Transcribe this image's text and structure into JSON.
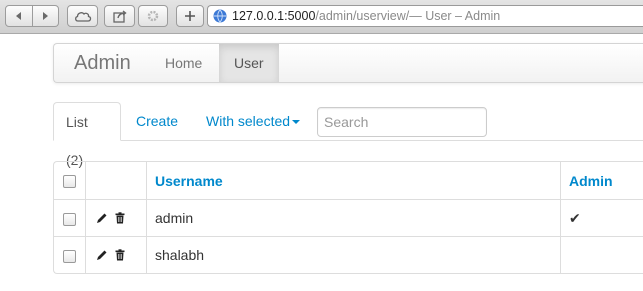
{
  "browser": {
    "url_host": "127.0.0.1:5000",
    "url_path": "/admin/userview/",
    "url_title": " — User – Admin",
    "buttons": [
      "back-icon",
      "forward-icon",
      "icloud-icon",
      "share-icon",
      "settings-icon",
      "add-tab-icon"
    ]
  },
  "navbar": {
    "brand": "Admin",
    "items": [
      {
        "label": "Home",
        "active": false
      },
      {
        "label": "User",
        "active": true
      }
    ]
  },
  "tabs": {
    "list": "List (2)",
    "create": "Create",
    "with_selected": "With selected"
  },
  "search": {
    "placeholder": "Search",
    "value": ""
  },
  "table": {
    "columns": [
      "Username",
      "Admin"
    ],
    "rows": [
      {
        "username": "admin",
        "admin": "✔"
      },
      {
        "username": "shalabh",
        "admin": ""
      }
    ]
  },
  "colors": {
    "link": "#0088cc",
    "nav_active_bg": "#e5e5e5",
    "border": "#dddddd"
  }
}
